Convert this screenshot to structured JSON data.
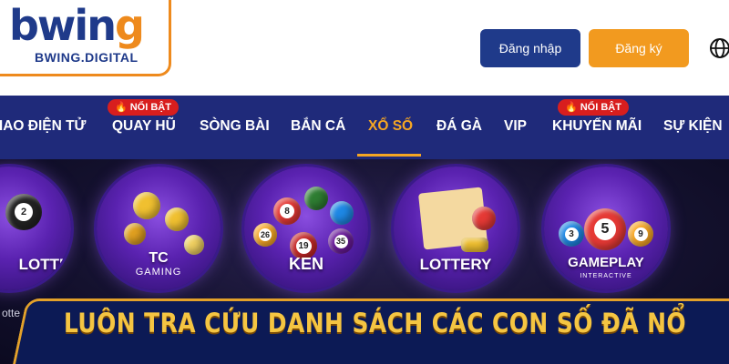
{
  "header": {
    "logo_text_main": "bwin",
    "logo_text_g": "g",
    "logo_sub": "BWING.DIGITAL",
    "login_label": "Đăng nhập",
    "register_label": "Đăng ký"
  },
  "nav": {
    "items": [
      {
        "label": "HAO ĐIỆN TỬ"
      },
      {
        "label": "QUAY HŨ",
        "badge": "NỔI BẬT"
      },
      {
        "label": "SÒNG BÀI"
      },
      {
        "label": "BẮN CÁ"
      },
      {
        "label": "XỔ SỐ",
        "active": true
      },
      {
        "label": "ĐÁ GÀ"
      },
      {
        "label": "VIP"
      },
      {
        "label": "KHUYẾN MÃI",
        "badge": "NỔI BẬT"
      },
      {
        "label": "SỰ KIỆN"
      }
    ],
    "active_color": "#f5a623",
    "bg_color": "#1f2a7a"
  },
  "games": {
    "cards": [
      {
        "label": "LOTTERY"
      },
      {
        "label": "TC",
        "sub": "GAMING"
      },
      {
        "label": "KEN"
      },
      {
        "label": "LOTTERY"
      },
      {
        "label": "GAMEPLAY",
        "sub": "INTERACTIVE"
      }
    ],
    "ball_numbers": [
      "2",
      "8",
      "5",
      "19",
      "35",
      "26",
      "3",
      "9"
    ],
    "fragment": "otte"
  },
  "banner": {
    "text": "LUÔN TRA CỨU DANH SÁCH CÁC CON SỐ ĐÃ NỔ"
  },
  "colors": {
    "brand_blue": "#1f3a8a",
    "brand_orange": "#ee8a1d",
    "badge_red": "#d81e1e",
    "banner_gold": "#f5c542"
  }
}
